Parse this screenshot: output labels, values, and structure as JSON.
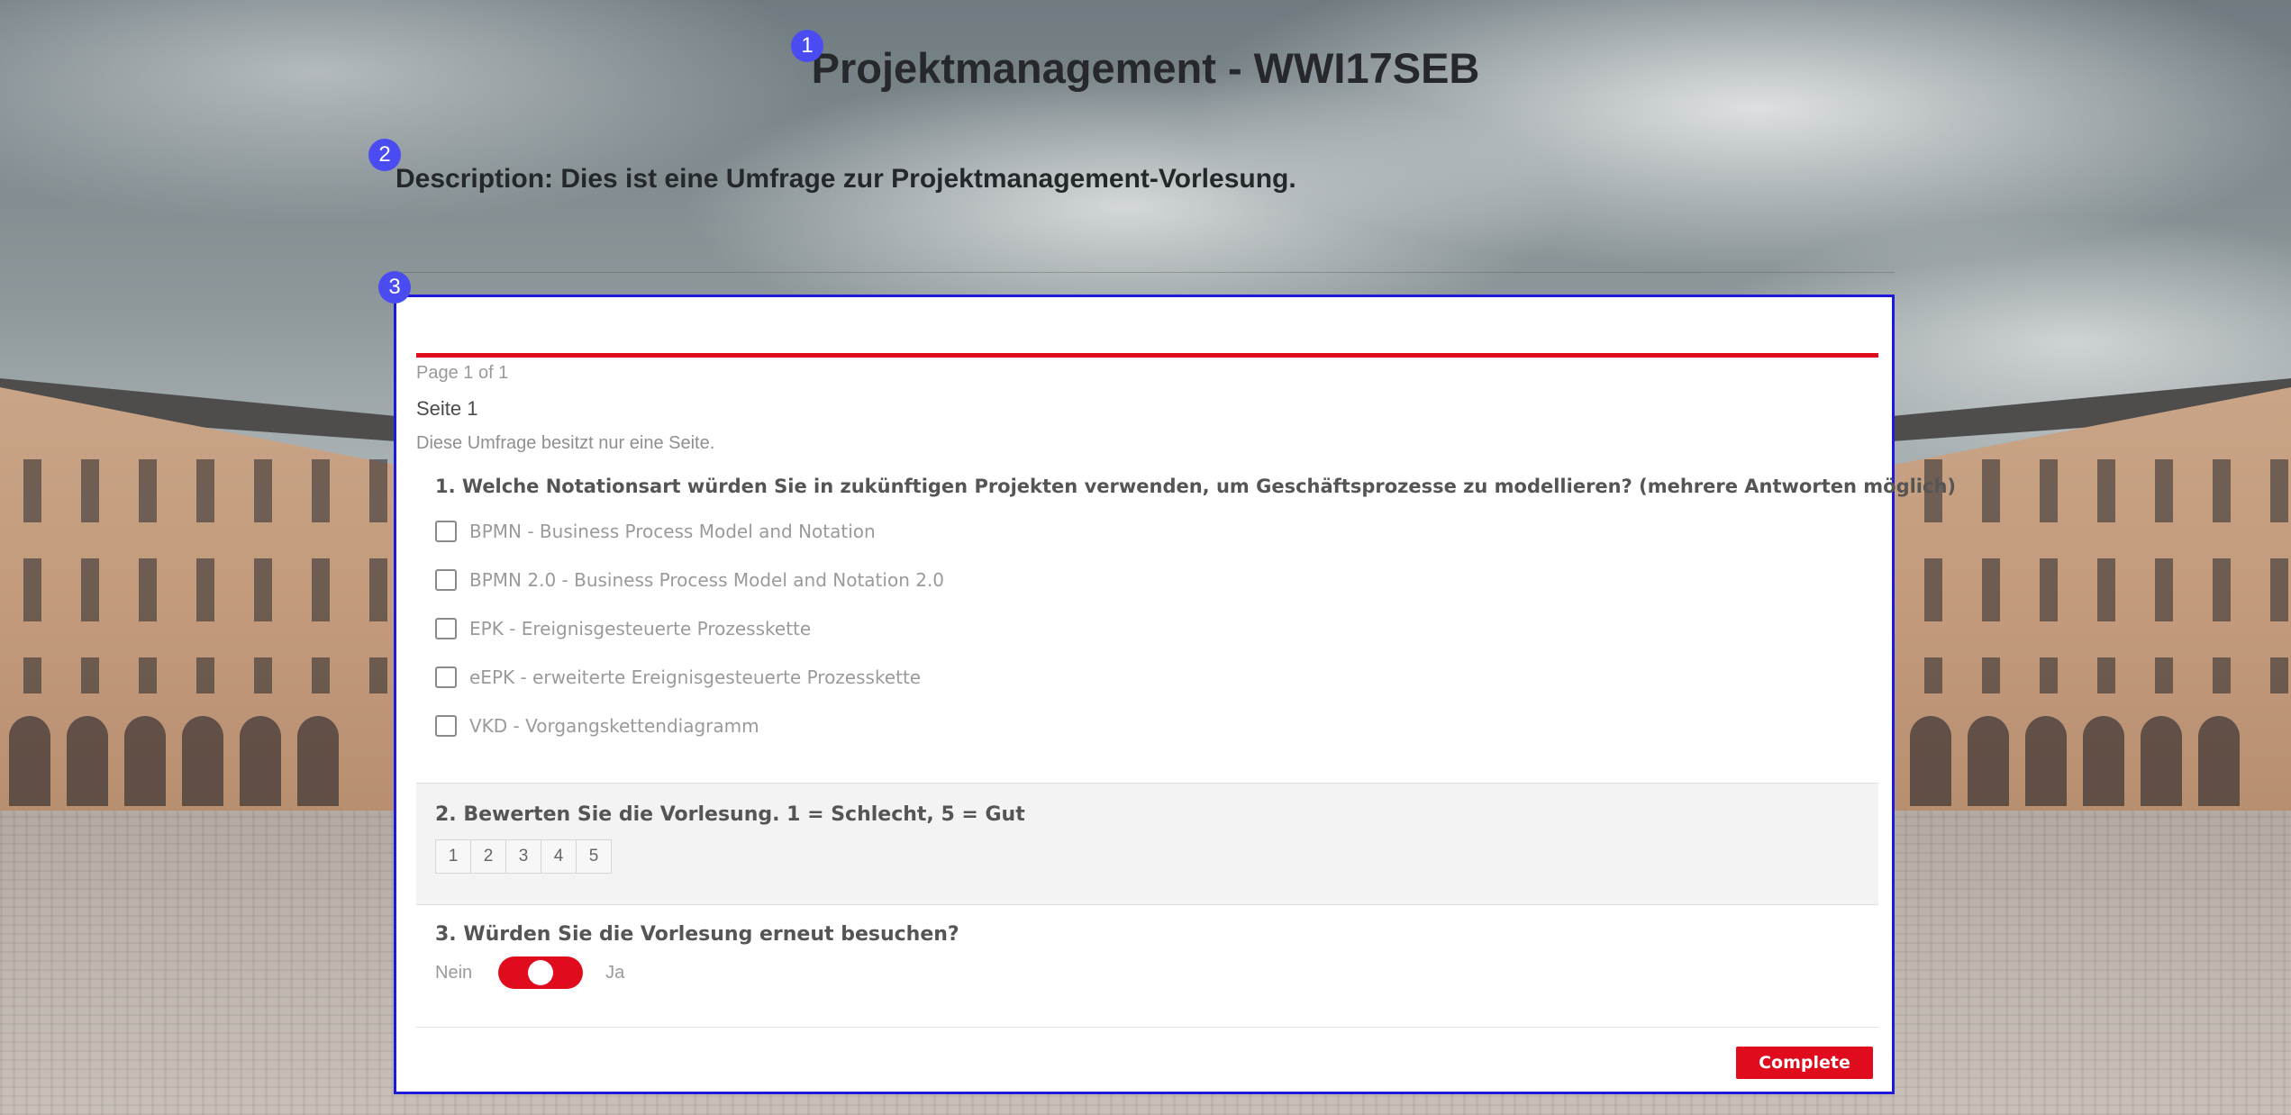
{
  "page": {
    "title": "Projektmanagement - WWI17SEB",
    "description": "Description: Dies ist eine Umfrage zur Projektmanagement-Vorlesung."
  },
  "badges": [
    "1",
    "2",
    "3"
  ],
  "survey": {
    "progress": 1.0,
    "page_indicator": "Page 1 of 1",
    "section_title": "Seite 1",
    "section_description": "Diese Umfrage besitzt nur eine Seite.",
    "accent_color": "#e00b1c",
    "questions": [
      {
        "title": "1. Welche Notationsart würden Sie in zukünftigen Projekten verwenden, um Geschäftsprozesse zu modellieren? (mehrere Antworten möglich)",
        "options": [
          "BPMN - Business Process Model and Notation",
          "BPMN 2.0 - Business Process Model and Notation 2.0",
          "EPK - Ereignisgesteuerte Prozesskette",
          "eEPK - erweiterte Ereignisgesteuerte Prozesskette",
          "VKD - Vorgangskettendiagramm"
        ]
      },
      {
        "title": "2. Bewerten Sie die Vorlesung. 1 = Schlecht, 5 = Gut",
        "rating": [
          "1",
          "2",
          "3",
          "4",
          "5"
        ]
      },
      {
        "title": "3. Würden Sie die Vorlesung erneut besuchen?",
        "toggle_off_label": "Nein",
        "toggle_on_label": "Ja"
      }
    ],
    "complete_label": "Complete"
  }
}
